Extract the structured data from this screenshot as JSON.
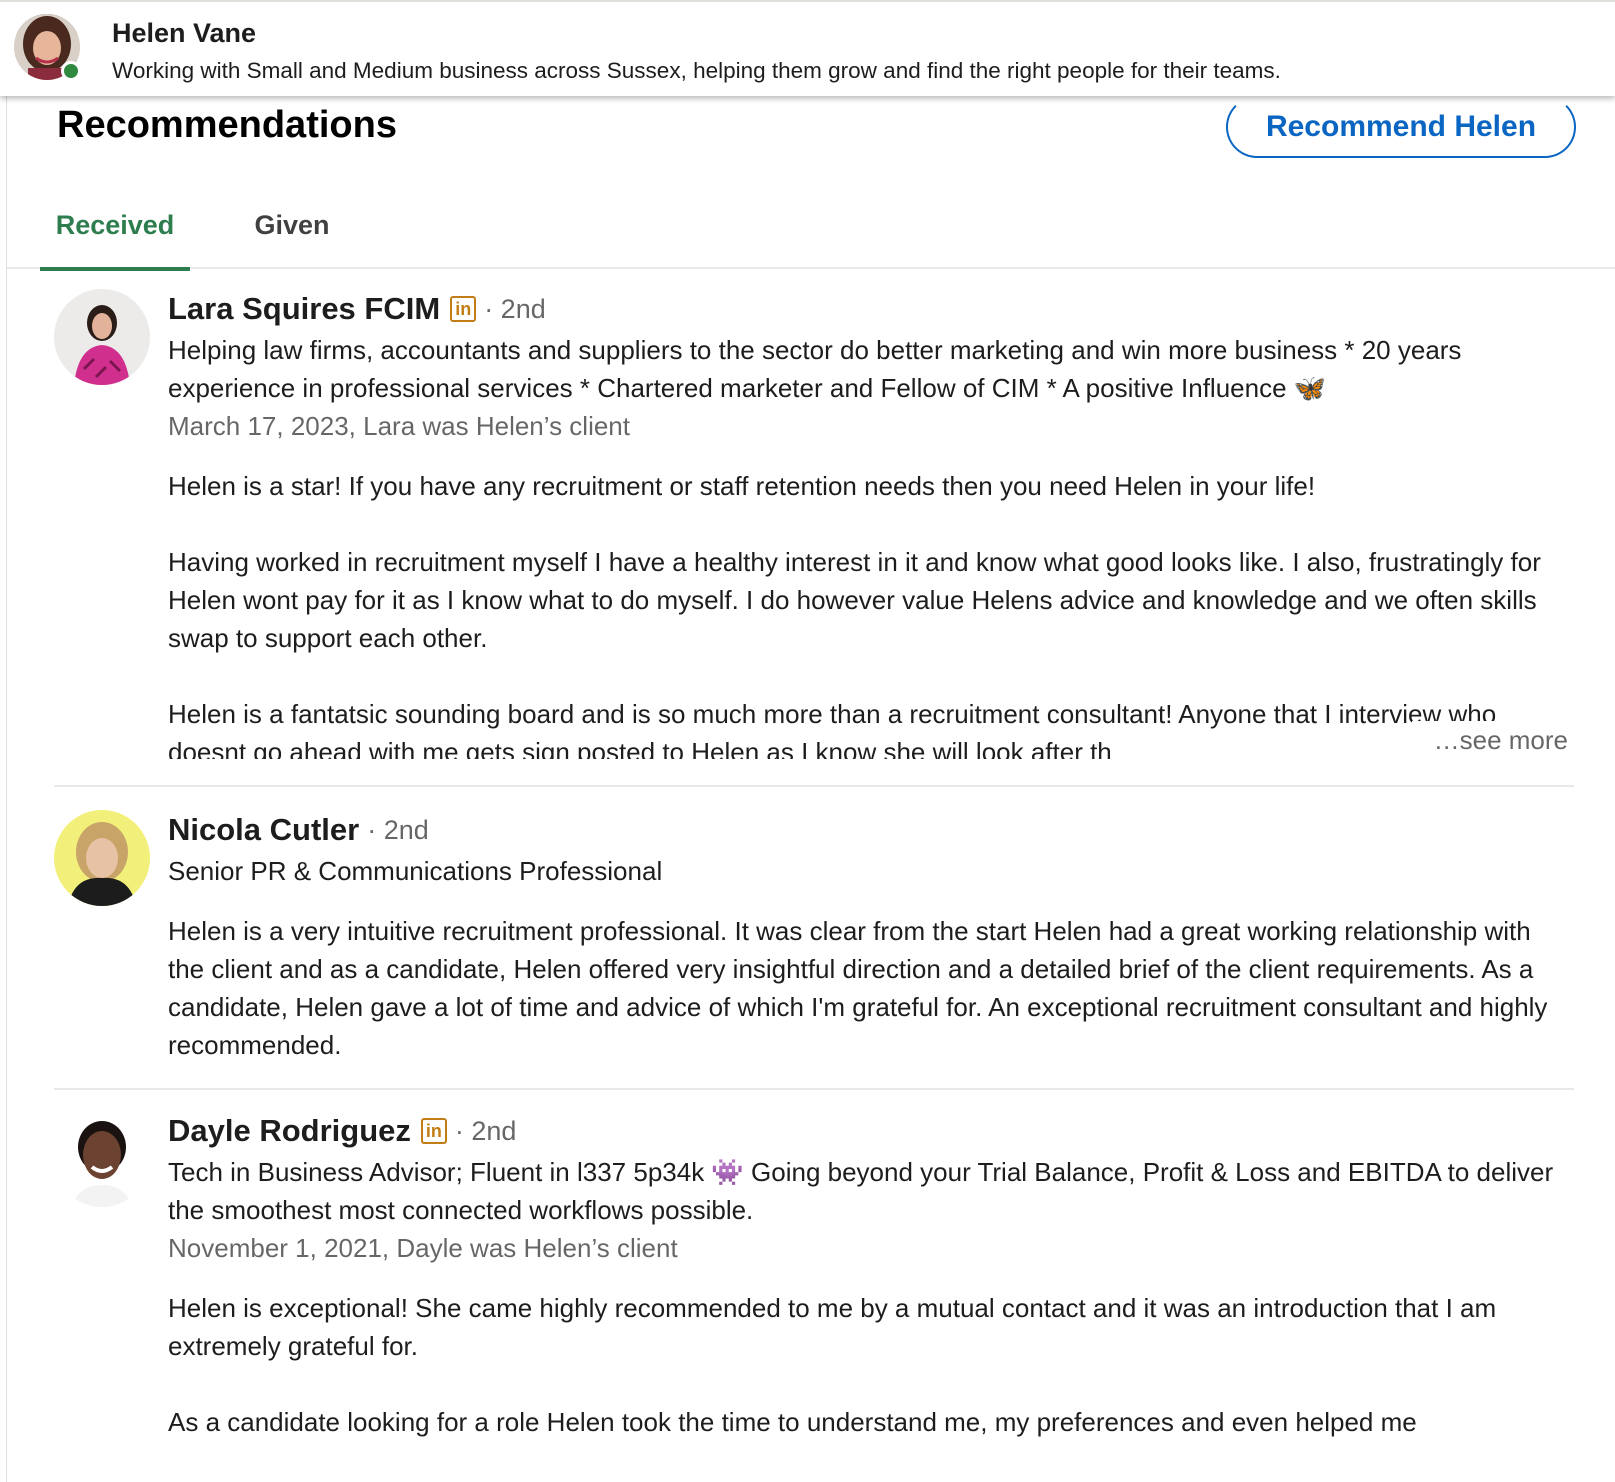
{
  "profile_header": {
    "name": "Helen Vane",
    "headline": "Working with Small and Medium business across Sussex, helping them grow and find the right people for their teams."
  },
  "section": {
    "title": "Recommendations",
    "recommend_button": "Recommend Helen"
  },
  "tabs": [
    {
      "label": "Received",
      "active": true
    },
    {
      "label": "Given",
      "active": false
    }
  ],
  "recommendations": [
    {
      "name": "Lara Squires FCIM",
      "linkedin_badge": "in",
      "degree": "· 2nd",
      "headline": "Helping law firms, accountants and suppliers to the sector do better marketing and win more business * 20 years experience in professional services * Chartered marketer and Fellow of CIM * A positive Influence 🦋",
      "meta": "March 17, 2023, Lara was Helen’s client",
      "text": "Helen is a star! If you have any recruitment or staff retention needs then you need Helen in your life!\n\nHaving worked in recruitment myself I have a healthy interest in it and know what good looks like. I also, frustratingly for Helen wont pay for it as I know what to do myself. I do however value Helens advice and knowledge and we often skills swap to support each other.\n\nHelen is a fantatsic sounding board and is so much more than a recruitment consultant! Anyone that I interview who doesnt go ahead with me gets sign posted to Helen as I know she will look after th",
      "see_more": "…see more"
    },
    {
      "name": "Nicola Cutler",
      "degree": "· 2nd",
      "headline": "Senior PR & Communications Professional",
      "text": "Helen is a very intuitive recruitment professional. It was clear from the start Helen had a great working relationship with the client and as a candidate, Helen offered very insightful direction and a detailed brief of the client requirements. As a candidate, Helen gave a lot of time and advice of which I'm grateful for. An exceptional recruitment consultant and highly recommended."
    },
    {
      "name": "Dayle Rodriguez",
      "linkedin_badge": "in",
      "degree": "· 2nd",
      "headline": "Tech in Business Advisor; Fluent in l337 5p34k 👾 Going beyond your Trial Balance, Profit & Loss and EBITDA to deliver the smoothest most connected workflows possible.",
      "meta": "November 1, 2021, Dayle was Helen’s client",
      "text": "Helen is exceptional! She came highly recommended to me by a mutual contact and it was an introduction that I am extremely grateful for.\n\nAs a candidate looking for a role Helen took the time to understand me, my preferences and even helped me"
    }
  ],
  "colors": {
    "accent_blue": "#0a66c2",
    "active_tab_green": "#2e7d4f",
    "online_green": "#2f8a3f",
    "linkedin_badge_gold": "#c37d16"
  },
  "icons": [
    "online-status-icon",
    "linkedin-premium-icon",
    "butterfly-emoji",
    "alien-monster-emoji"
  ]
}
